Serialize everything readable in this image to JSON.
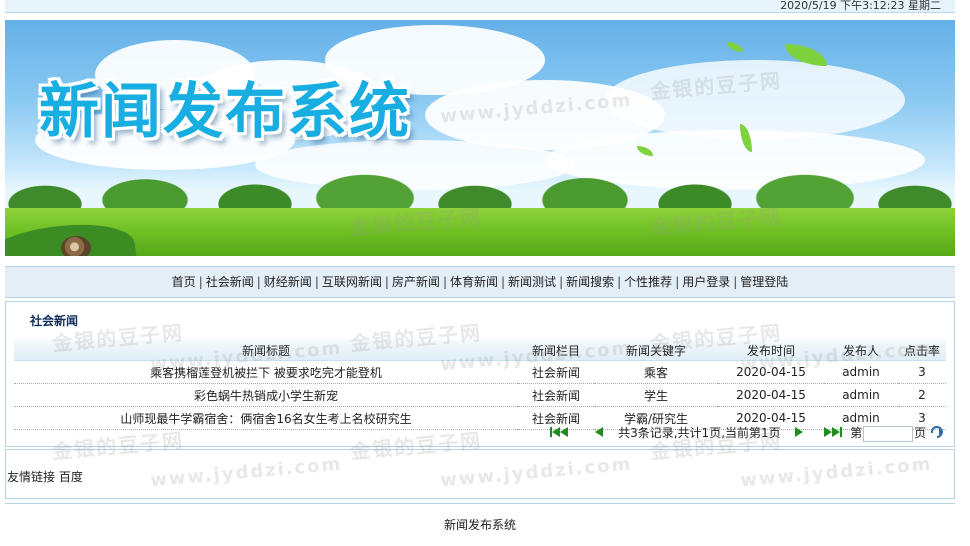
{
  "topbar": {
    "datetime": "2020/5/19 下午3:12:23  星期二"
  },
  "banner": {
    "title": "新闻发布系统"
  },
  "nav": {
    "items": [
      "首页",
      "社会新闻",
      "财经新闻",
      "互联网新闻",
      "房产新闻",
      "体育新闻",
      "新闻测试",
      "新闻搜索",
      "个性推荐",
      "用户登录",
      "管理登陆"
    ],
    "separator": "|"
  },
  "section": {
    "title": "社会新闻"
  },
  "table": {
    "headers": [
      "新闻标题",
      "新闻栏目",
      "新闻关键字",
      "发布时间",
      "发布人",
      "点击率"
    ],
    "rows": [
      [
        "乘客携榴莲登机被拦下 被要求吃完才能登机",
        "社会新闻",
        "乘客",
        "2020-04-15",
        "admin",
        "3"
      ],
      [
        "彩色蜗牛热销成小学生新宠",
        "社会新闻",
        "学生",
        "2020-04-15",
        "admin",
        "2"
      ],
      [
        "山师现最牛学霸宿舍：俩宿舍16名女生考上名校研究生",
        "社会新闻",
        "学霸/研究生",
        "2020-04-15",
        "admin",
        "3"
      ]
    ]
  },
  "pager": {
    "summary": "共3条记录,共计1页,当前第1页",
    "page_prefix": "第",
    "page_suffix": "页",
    "page_value": ""
  },
  "links": {
    "label": "友情链接",
    "items": [
      "百度"
    ]
  },
  "footer": {
    "text": "新闻发布系统"
  },
  "watermark": {
    "cn": "金银的豆子网",
    "en": "www.jyddzi.com"
  },
  "colors": {
    "title": "#18aee2",
    "accent_border": "#b7d3e6",
    "nav_bg": "#e3eef6",
    "pager_green": "#1e8e1e"
  },
  "icons": [
    "first-page-icon",
    "prev-page-icon",
    "next-page-icon",
    "last-page-icon",
    "go-icon"
  ]
}
